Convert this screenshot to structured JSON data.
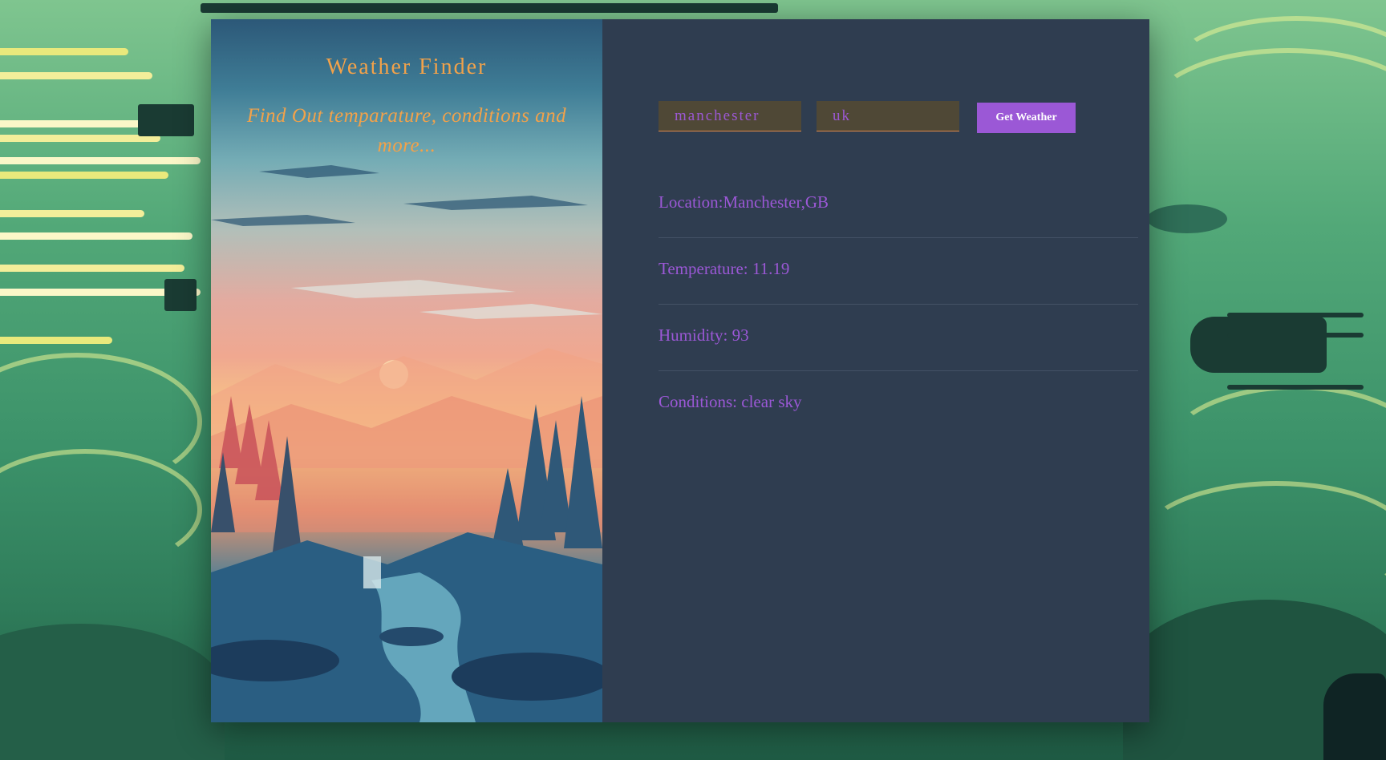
{
  "app": {
    "title": "Weather Finder",
    "subtitle": "Find Out temparature, conditions and more..."
  },
  "form": {
    "city_value": "manchester",
    "country_value": "uk",
    "submit_label": "Get Weather"
  },
  "results": {
    "location": {
      "label": "Location:",
      "value": "Manchester,GB"
    },
    "temperature": {
      "label": "Temperature: ",
      "value": "11.19"
    },
    "humidity": {
      "label": "Humidity: ",
      "value": "93"
    },
    "conditions": {
      "label": "Conditions: ",
      "value": "clear sky"
    }
  },
  "colors": {
    "accent": "#9b58d6",
    "title": "#f2a24a",
    "panel_background": "#2f3d50",
    "input_background": "#4f4836"
  }
}
